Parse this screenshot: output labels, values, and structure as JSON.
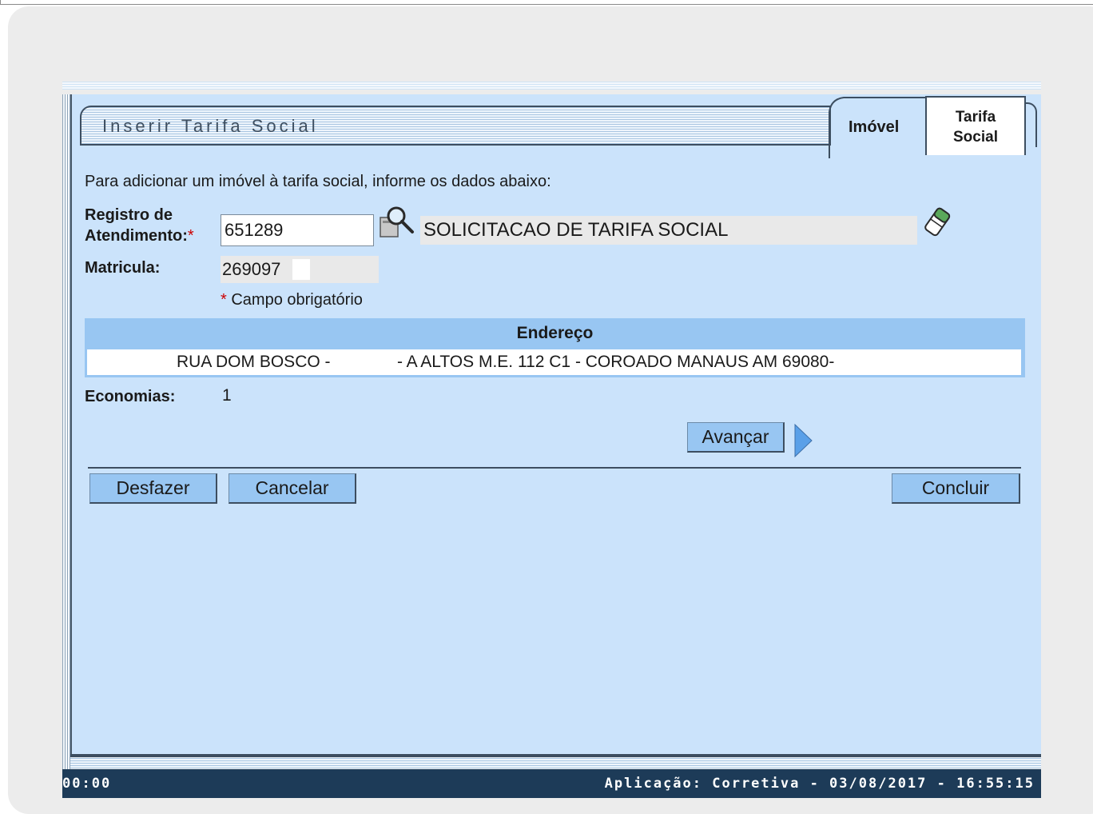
{
  "page": {
    "title": "Inserir Tarifa Social",
    "tabs": [
      {
        "label": "Imóvel"
      },
      {
        "label_line1": "Tarifa",
        "label_line2": "Social"
      }
    ]
  },
  "form": {
    "intro": "Para adicionar um imóvel à tarifa social, informe os dados abaixo:",
    "registro": {
      "label_line1": "Registro de",
      "label_line2": "Atendimento:",
      "required_mark": "*",
      "value": "651289",
      "description": "SOLICITACAO DE TARIFA SOCIAL"
    },
    "matricula": {
      "label": "Matricula:",
      "value": "269097"
    },
    "required_note": {
      "mark": "*",
      "text": " Campo obrigatório"
    },
    "endereco": {
      "header": "Endereço",
      "part1": "RUA DOM BOSCO -",
      "part2": "- A ALTOS M.E. 112 C1 - COROADO MANAUS AM 69080-"
    },
    "economias": {
      "label": "Economias:",
      "value": "1"
    }
  },
  "buttons": {
    "avancar": "Avançar",
    "desfazer": "Desfazer",
    "cancelar": "Cancelar",
    "concluir": "Concluir"
  },
  "status": {
    "left": "00:00",
    "right": "Aplicação: Corretiva - 03/08/2017 - 16:55:15"
  },
  "icons": {
    "search": "magnifier-icon",
    "clear": "eraser-icon",
    "next": "arrow-right-icon"
  },
  "colors": {
    "panel": "#cbe3fb",
    "header": "#98c6f2",
    "statusbar": "#1d3b58",
    "required": "#cc0000"
  }
}
